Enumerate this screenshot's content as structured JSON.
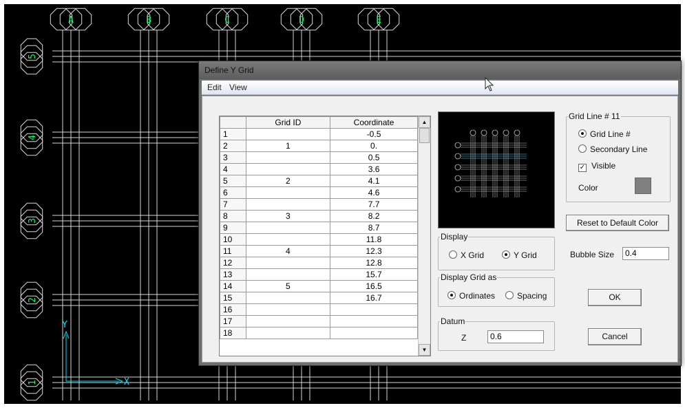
{
  "viewport": {
    "column_labels": [
      "A",
      "B",
      "C",
      "D",
      "E"
    ],
    "row_labels": [
      "5",
      "4",
      "3",
      "2",
      "1"
    ],
    "axis_x": "X",
    "axis_y": "Y"
  },
  "dialog": {
    "title": "Define Y Grid",
    "menu": [
      "Edit",
      "View"
    ],
    "table": {
      "headers": [
        "",
        "Grid ID",
        "Coordinate"
      ],
      "rows": [
        [
          "1",
          "",
          "-0.5"
        ],
        [
          "2",
          "1",
          "0."
        ],
        [
          "3",
          "",
          "0.5"
        ],
        [
          "4",
          "",
          "3.6"
        ],
        [
          "5",
          "2",
          "4.1"
        ],
        [
          "6",
          "",
          "4.6"
        ],
        [
          "7",
          "",
          "7.7"
        ],
        [
          "8",
          "3",
          "8.2"
        ],
        [
          "9",
          "",
          "8.7"
        ],
        [
          "10",
          "",
          "11.8"
        ],
        [
          "11",
          "4",
          "12.3"
        ],
        [
          "12",
          "",
          "12.8"
        ],
        [
          "13",
          "",
          "15.7"
        ],
        [
          "14",
          "5",
          "16.5"
        ],
        [
          "15",
          "",
          "16.7"
        ],
        [
          "16",
          "",
          ""
        ],
        [
          "17",
          "",
          ""
        ],
        [
          "18",
          "",
          ""
        ]
      ]
    },
    "display": {
      "legend": "Display",
      "x_grid": "X Grid",
      "y_grid": "Y Grid",
      "selected": "Y Grid"
    },
    "display_grid_as": {
      "legend": "Display Grid as",
      "ordinates": "Ordinates",
      "spacing": "Spacing",
      "selected": "Ordinates"
    },
    "datum": {
      "legend": "Datum",
      "label": "Z",
      "value": "0.6"
    },
    "grid_line": {
      "legend": "Grid Line # 11",
      "option_grid_line": "Grid Line #",
      "option_secondary": "Secondary Line",
      "selected": "Grid Line #",
      "visible_label": "Visible",
      "visible_checked": true,
      "color_label": "Color",
      "color_value": "#808080"
    },
    "reset_color_label": "Reset to Default Color",
    "bubble_size_label": "Bubble Size",
    "bubble_size_value": "0.4",
    "ok_label": "OK",
    "cancel_label": "Cancel"
  }
}
